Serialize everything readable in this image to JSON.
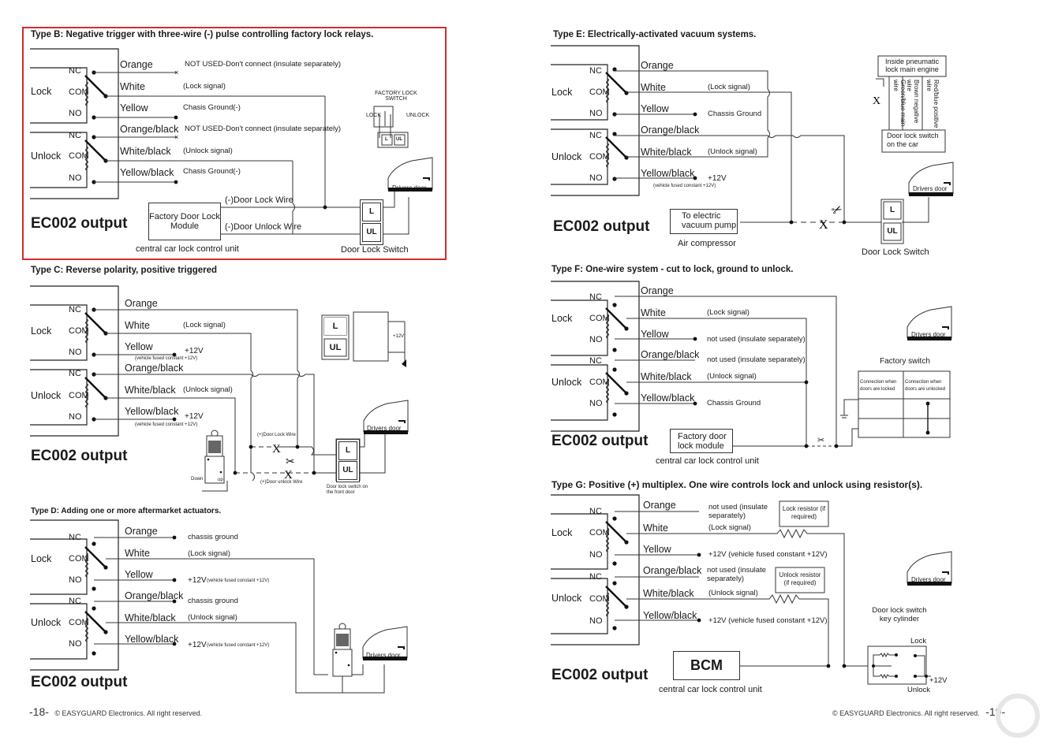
{
  "accent_color": "#d32b2b",
  "relay_labels": {
    "lock": "Lock",
    "unlock": "Unlock",
    "nc": "NC",
    "com": "COM",
    "no": "NO"
  },
  "ec_output": "EC002 output",
  "wires": [
    "Orange",
    "White",
    "Yellow",
    "Orange/black",
    "White/black",
    "Yellow/black"
  ],
  "typeB": {
    "title": "Type B: Negative trigger with three-wire (-) pulse controlling factory lock relays.",
    "notes": [
      "NOT USED-Don't connect (insulate separately)",
      "(Lock signal)",
      "Chasis Ground(-)",
      "NOT USED-Don't connect (insulate separately)",
      "(Unlock signal)",
      "Chasis Ground(-)"
    ],
    "factory_switch_title": "FACTORY LOCK SWITCH",
    "factory_switch_lock": "LOCK",
    "factory_switch_unlock": "UNLOCK",
    "module": "Factory Door Lock Module",
    "module_caption": "central car lock control unit",
    "door_lock_wire": "(-)Door Lock Wire",
    "door_unlock_wire": "(-)Door Unlock Wire",
    "switch_caption": "Door Lock Switch",
    "btn_l": "L",
    "btn_ul": "UL",
    "drivers_door": "Drivers door"
  },
  "typeC": {
    "title": "Type C: Reverse polarity, positive triggered",
    "notes": [
      "",
      "(Lock signal)",
      "+12V",
      "",
      "(Unlock signal)",
      "+12V"
    ],
    "fused_note": "(vehicle fused constant +12V)",
    "plus12": "+12V",
    "door_lock_wire": "(+)Door Lock Wire",
    "door_unlock_wire": "(+)Door unlock Wire",
    "actuator_down": "Down",
    "actuator_up": "up",
    "switch_caption": "Door lock switch on the front door",
    "btn_l": "L",
    "btn_ul": "UL",
    "drivers_door": "Drivers door"
  },
  "typeD": {
    "title": "Type D: Adding one or more aftermarket actuators.",
    "notes": [
      "chassis ground",
      "(Lock signal)",
      "+12V",
      "chassis ground",
      "(Unlock signal)",
      "+12V"
    ],
    "fused_note": "(vehicle fused constant +12V)",
    "drivers_door": "Drivers door"
  },
  "typeE": {
    "title": "Type E: Electrically-activated vacuum systems.",
    "notes": [
      "",
      "(Lock signal)",
      "Chassis Ground",
      "",
      "(Unlock signal)",
      "+12V"
    ],
    "fused_note": "(vehicle fused constant +12V)",
    "engine_box": "Inside pneumatic lock main engine",
    "engine_wires": [
      "Green/blue main wire",
      "Brown negative wire",
      "Red/blue positive wire"
    ],
    "switch_on_car": "Door lock switch on the car",
    "pump_box": "To electric vacuum pump",
    "pump_caption": "Air compressor",
    "switch_caption": "Door Lock Switch",
    "btn_l": "L",
    "btn_ul": "UL",
    "drivers_door": "Drivers door"
  },
  "typeF": {
    "title": "Type F: One-wire system - cut to lock, ground to unlock.",
    "notes": [
      "",
      "(Lock signal)",
      "not used (insulate separately)",
      "not used (insulate separately)",
      "(Unlock signal)",
      "Chassis Ground"
    ],
    "factory_switch": "Factory switch",
    "col_locked": "Connection when doors are locked",
    "col_unlocked": "Connection when doors are unlocked",
    "module": "Factory door lock module",
    "module_caption": "central car lock control unit",
    "drivers_door": "Drivers door"
  },
  "typeG": {
    "title": "Type G: Positive (+) multiplex. One wire controls lock and unlock using resistor(s).",
    "notes": [
      "not used (insulate separately)",
      "(Lock signal)",
      "+12V (vehicle fused constant +12V)",
      "not used (insulate separately)",
      "(Unlock signal)",
      "+12V (vehicle fused constant +12V)"
    ],
    "lock_resistor": "Lock resistor (if required)",
    "unlock_resistor": "Unlock resistor (if required)",
    "bcm": "BCM",
    "bcm_caption": "central car lock control unit",
    "key_cylinder": "Door lock switch key cylinder",
    "key_lock": "Lock",
    "key_unlock": "Unlock",
    "key_plus12": "+12V",
    "drivers_door": "Drivers door"
  },
  "footer": {
    "left_page": "-18-",
    "right_page": "-19-",
    "copyright": "© EASYGUARD  Electronics.  All  right reserved."
  }
}
